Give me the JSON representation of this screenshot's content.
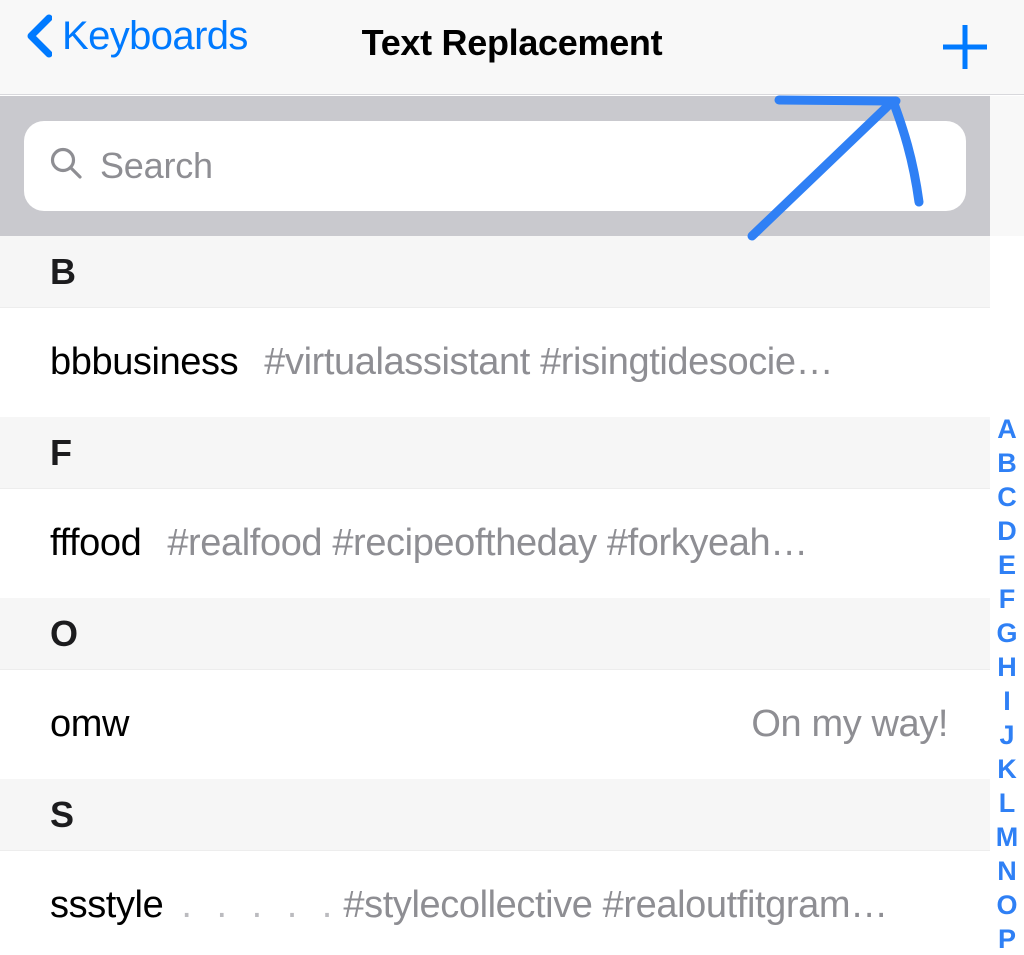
{
  "navbar": {
    "back_label": "Keyboards",
    "back_icon": "chevron-left-icon",
    "title": "Text Replacement",
    "add_icon": "plus-icon"
  },
  "search": {
    "placeholder": "Search",
    "value": "",
    "icon": "search-icon"
  },
  "list": {
    "sections": [
      {
        "header": "B",
        "rows": [
          {
            "shortcut": "bbbusiness",
            "leader": "",
            "phrase": "#virtualassistant #risingtidesocie…",
            "align": "left"
          }
        ]
      },
      {
        "header": "F",
        "rows": [
          {
            "shortcut": "fffood",
            "leader": "",
            "phrase": "#realfood #recipeoftheday #forkyeah…",
            "align": "left"
          }
        ]
      },
      {
        "header": "O",
        "rows": [
          {
            "shortcut": "omw",
            "leader": "",
            "phrase": "On my way!",
            "align": "right"
          }
        ]
      },
      {
        "header": "S",
        "rows": [
          {
            "shortcut": "ssstyle",
            "leader": ". . . . .",
            "phrase": "#stylecollective #realoutfitgram…",
            "align": "left"
          }
        ]
      }
    ]
  },
  "index": {
    "letters": [
      "A",
      "B",
      "C",
      "D",
      "E",
      "F",
      "G",
      "H",
      "I",
      "J",
      "K",
      "L",
      "M",
      "N",
      "O",
      "P"
    ]
  },
  "annotation": {
    "type": "hand-drawn-arrow",
    "points_to": "add-button",
    "color": "#2F80F5"
  },
  "colors": {
    "accent_blue": "#007AFF",
    "index_blue": "#2F80F5",
    "navbar_bg": "#F8F8F8",
    "search_band_bg": "#C9C9CE",
    "section_header_bg": "#F6F6F6",
    "row_bg": "#FFFFFF",
    "secondary_text": "#8E8E93",
    "primary_text": "#000000"
  }
}
